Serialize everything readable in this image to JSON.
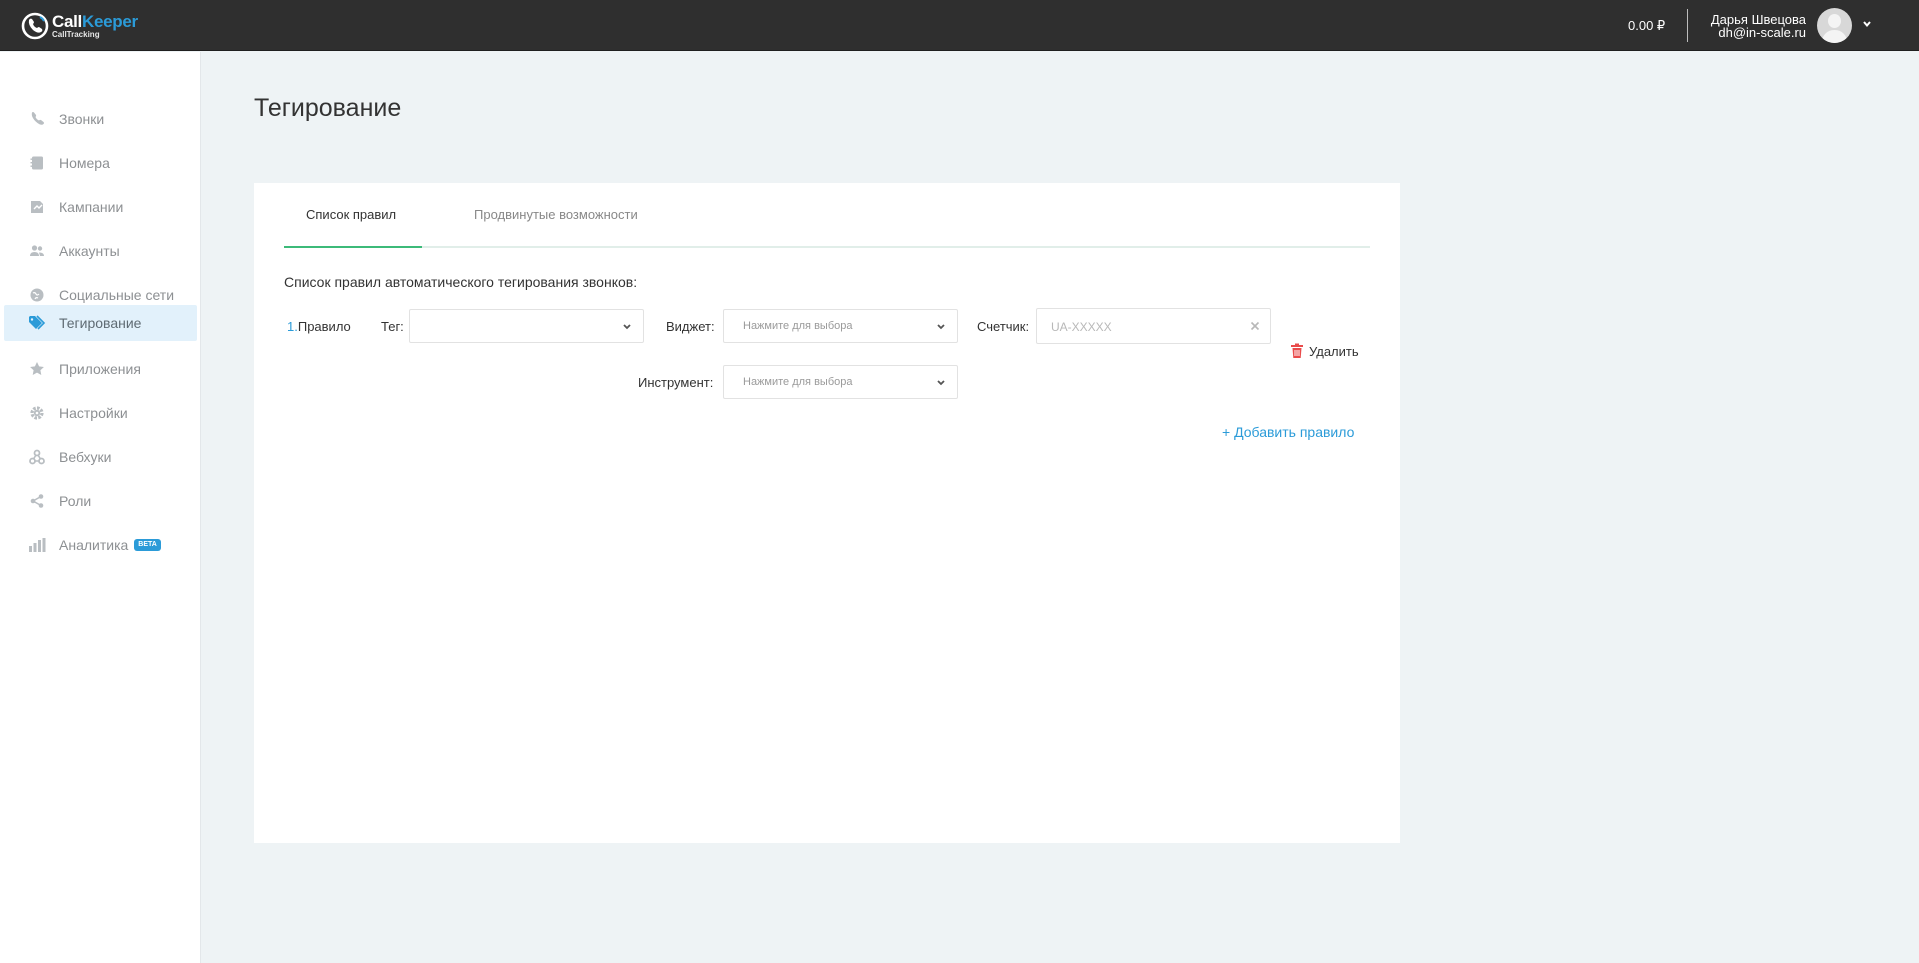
{
  "header": {
    "logo": {
      "call": "Call",
      "keeper": "Keeper",
      "sub": "CallTracking"
    },
    "balance": "0.00 ₽",
    "user": {
      "name": "Дарья Швецова",
      "email": "dh@in-scale.ru"
    }
  },
  "sidebar": {
    "items": [
      {
        "label": "Звонки",
        "icon": "phone-icon"
      },
      {
        "label": "Номера",
        "icon": "numbers-icon"
      },
      {
        "label": "Кампании",
        "icon": "campaigns-icon"
      },
      {
        "label": "Аккаунты",
        "icon": "users-icon"
      },
      {
        "label": "Социальные сети",
        "icon": "globe-icon"
      },
      {
        "label": "Тегирование",
        "icon": "tags-icon",
        "active": true
      },
      {
        "label": "Приложения",
        "icon": "star-icon"
      },
      {
        "label": "Настройки",
        "icon": "gear-icon"
      },
      {
        "label": "Вебхуки",
        "icon": "webhook-icon"
      },
      {
        "label": "Роли",
        "icon": "share-icon"
      },
      {
        "label": "Аналитика",
        "icon": "bar-chart-icon",
        "badge": "BETA"
      }
    ]
  },
  "main": {
    "title": "Тегирование",
    "tabs": [
      {
        "label": "Список правил",
        "active": true
      },
      {
        "label": "Продвинутые возможности"
      }
    ],
    "description": "Список правил автоматического тегирования звонков:",
    "rule": {
      "number": "1.",
      "label": "Правило",
      "tag_label": "Тег:",
      "tag_value": "",
      "widget_label": "Виджет:",
      "widget_placeholder": "Нажмите для выбора",
      "counter_label": "Счетчик:",
      "counter_placeholder": "UA-XXXXX",
      "tool_label": "Инструмент:",
      "tool_placeholder": "Нажмите для выбора",
      "delete_label": "Удалить"
    },
    "add_rule_label": "+ Добавить правило"
  },
  "colors": {
    "accent": "#2b9bd8",
    "tab_active": "#3cba79",
    "header_bg": "#2f2f2f",
    "delete_icon": "#e94b4b"
  }
}
